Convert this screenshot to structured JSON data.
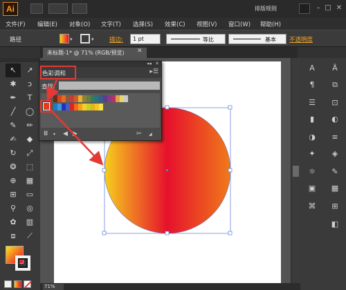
{
  "app": {
    "logo": "Ai",
    "workspace": "排版规则"
  },
  "menu": [
    "文件(F)",
    "编辑(E)",
    "对象(O)",
    "文字(T)",
    "选择(S)",
    "效果(C)",
    "视图(V)",
    "窗口(W)",
    "帮助(H)"
  ],
  "control": {
    "path_label": "路径",
    "stroke_label": "描边:",
    "stroke_value": "1 pt",
    "profile_label": "等比",
    "brush_label": "基本",
    "opacity_label": "不透明度"
  },
  "document": {
    "tab_title": "未标题-1* @ 71% (RGB/预览)",
    "zoom": "71%"
  },
  "color_guide": {
    "title": "色彩调和",
    "search_label": "查找:",
    "base_color": "#e23a1f",
    "row1": [
      "#6d2a14",
      "#d9451c",
      "#e46b29",
      "#8a5a3a",
      "#c73b3b",
      "#c7602b",
      "#e6b32f",
      "#8f7f3a",
      "#6b7d3c",
      "#357b63",
      "#2f6f7c",
      "#395a8c",
      "#5b3d8c",
      "#8a3a82",
      "#b2336a",
      "#d8a14a",
      "#e7d36e",
      "#c9c9c9"
    ],
    "row2": [
      "#1e7bbf",
      "#3a9bd5",
      "#2b2fb5",
      "#3b60d6",
      "#e2231a",
      "#f06a1a",
      "#f4a21c",
      "#f5d024",
      "#c4d12b",
      "#e2b51b",
      "#f0c72a",
      "#f7e24a"
    ]
  },
  "colors": {
    "accent_orange": "#f0a428",
    "annotation_red": "#e53935",
    "gradient_start": "#f6cf1d",
    "gradient_mid": "#e6112c",
    "gradient_end": "#f07a1a"
  },
  "tools_left": [
    "selection-tool",
    "direct-selection-tool",
    "magic-wand-tool",
    "lasso-tool",
    "pen-tool",
    "type-tool",
    "line-tool",
    "ellipse-tool",
    "paintbrush-tool",
    "pencil-tool",
    "blob-brush-tool",
    "eraser-tool",
    "rotate-tool",
    "scale-tool",
    "warp-tool",
    "free-transform-tool",
    "shape-builder-tool",
    "perspective-grid-tool",
    "mesh-tool",
    "gradient-tool",
    "eyedropper-tool",
    "blend-tool",
    "symbol-sprayer-tool",
    "column-graph-tool",
    "artboard-tool",
    "slice-tool",
    "hand-tool",
    "zoom-tool"
  ],
  "panels_right": [
    "character-icon",
    "paragraph-icon",
    "opentype-icon",
    "align-icon",
    "transform-icon",
    "pathfinder-icon",
    "transparency-icon",
    "gradient-icon",
    "stroke-icon",
    "appearance-icon",
    "graphic-styles-icon",
    "layers-icon",
    "artboards-icon",
    "links-icon"
  ]
}
